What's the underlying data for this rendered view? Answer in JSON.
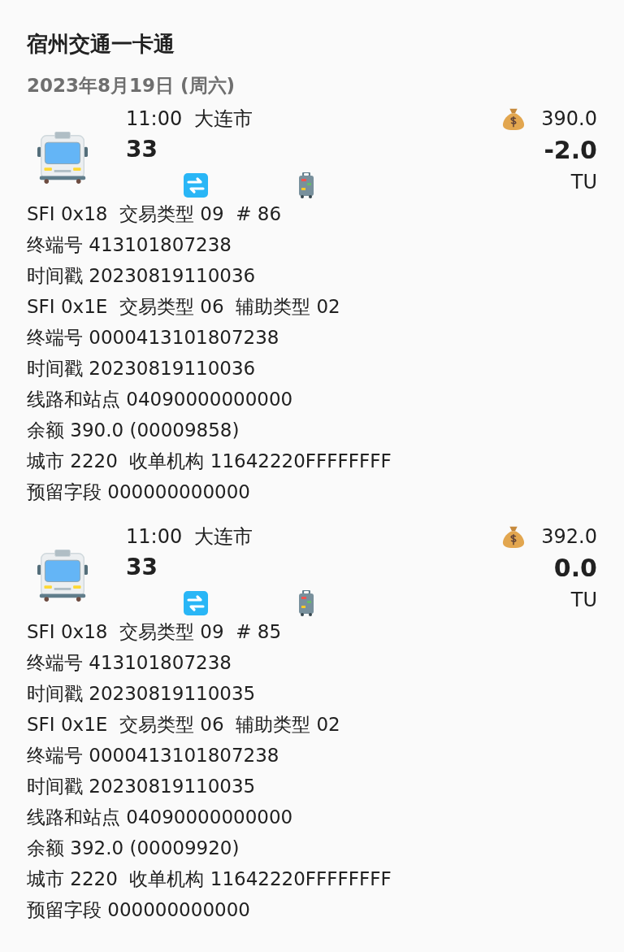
{
  "title": "宿州交通一卡通",
  "date": "2023年8月19日 (周六)",
  "records": [
    {
      "time_place": "11:00  大连市",
      "route": "33",
      "balance": "390.0",
      "amount": "-2.0",
      "unit": "TU",
      "lines": [
        "SFI 0x18  交易类型 09  # 86",
        "终端号 413101807238",
        "时间戳 20230819110036",
        "SFI 0x1E  交易类型 06  辅助类型 02",
        "终端号 0000413101807238",
        "时间戳 20230819110036",
        "线路和站点 04090000000000",
        "余额 390.0 (00009858)",
        "城市 2220  收单机构 11642220FFFFFFFF",
        "预留字段 000000000000"
      ]
    },
    {
      "time_place": "11:00  大连市",
      "route": "33",
      "balance": "392.0",
      "amount": "0.0",
      "unit": "TU",
      "lines": [
        "SFI 0x18  交易类型 09  # 85",
        "终端号 413101807238",
        "时间戳 20230819110035",
        "SFI 0x1E  交易类型 06  辅助类型 02",
        "终端号 0000413101807238",
        "时间戳 20230819110035",
        "线路和站点 04090000000000",
        "余额 392.0 (00009920)",
        "城市 2220  收单机构 11642220FFFFFFFF",
        "预留字段 000000000000"
      ]
    }
  ]
}
